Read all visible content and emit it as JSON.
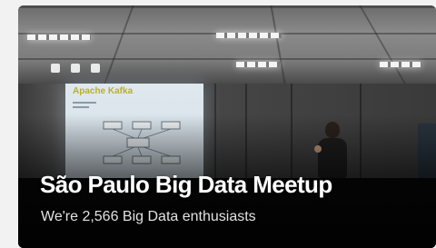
{
  "group": {
    "title": "São Paulo Big Data Meetup",
    "member_summary": "We're 2,566 Big Data enthusiasts"
  },
  "photo": {
    "slide_heading": "Apache Kafka"
  }
}
